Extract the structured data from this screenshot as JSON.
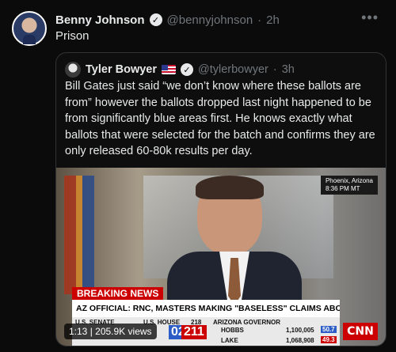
{
  "tweet": {
    "author_name": "Benny Johnson",
    "handle": "@bennyjohnson",
    "separator": "·",
    "time": "2h",
    "text": "Prison",
    "more_icon": "more-icon"
  },
  "quote": {
    "author_name": "Tyler Bowyer",
    "handle": "@tylerbowyer",
    "separator": "·",
    "time": "3h",
    "text": "Bill Gates just said “we don’t know where these ballots are from” however the ballots dropped last night happened to be from significantly blue areas first. He knows exactly what ballots that were selected for the batch and confirms they are only released 60-80k results per day."
  },
  "video": {
    "location": "Phoenix, Arizona",
    "local_time": "8:36 PM MT",
    "breaking_label": "BREAKING NEWS",
    "headline": "AZ OFFICIAL: RNC, MASTERS MAKING \"BASELESS\" CLAIMS ABOUT VOTE COUNTING",
    "ticker": {
      "senate_label": "U.S. SENATE",
      "house_label": "U.S. HOUSE",
      "house_r_value": "211",
      "house_d_value": "02",
      "house_needed": "218",
      "governor_label": "ARIZONA GOVERNOR",
      "hobbs_name": "HOBBS",
      "hobbs_votes": "1,100,005",
      "hobbs_pct": "50.7",
      "lake_name": "LAKE",
      "lake_votes": "1,068,908",
      "lake_pct": "49.3"
    },
    "network": "CNN",
    "elapsed": "1:13",
    "views": "205.9K views"
  },
  "colors": {
    "background": "#000000",
    "text": "#e7e9ea",
    "muted": "#71767b",
    "border": "#2f3336",
    "breaking_red": "#cc0000"
  }
}
